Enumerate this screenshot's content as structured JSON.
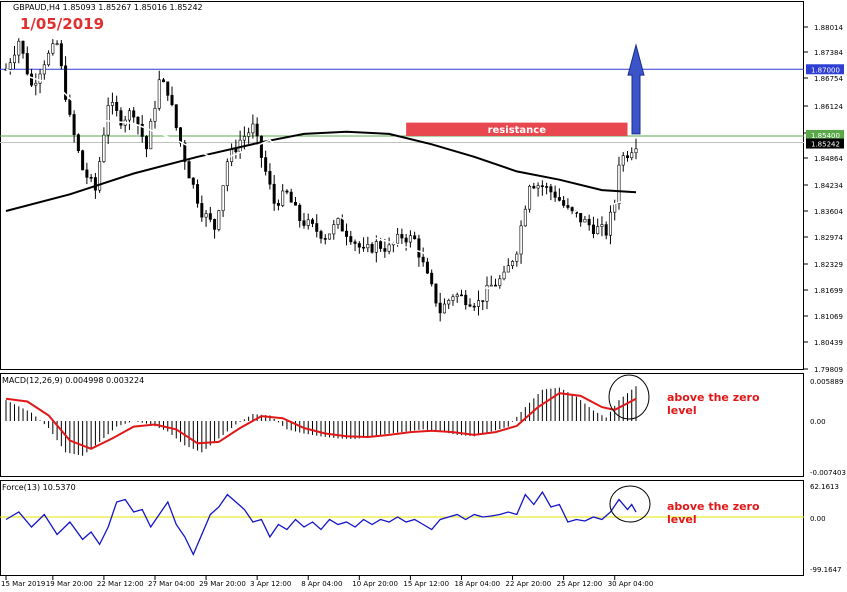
{
  "header": {
    "symbol_line": "GBPAUD,H4  1.85093 1.85267 1.85016 1.85242",
    "date_stamp": "1/05/2019"
  },
  "colors": {
    "date_stamp": "#e03030",
    "candle": "#000000",
    "ma_fast": "#ffffff",
    "ma_slow": "#000000",
    "blue_level": "#2f3fd4",
    "green_level": "#5aa84a",
    "resistance_box": "#e8474f",
    "arrow": "#3b55c9",
    "macd_hist": "#000000",
    "macd_signal": "#e01818",
    "force_line": "#1414c8",
    "force_zero": "#e6e600",
    "annotation": "#e01818"
  },
  "price_panel": {
    "ticks": [
      "1.88014",
      "1.87384",
      "1.86754",
      "1.86124",
      "1.85494",
      "1.84864",
      "1.84234",
      "1.83604",
      "1.82974",
      "1.82329",
      "1.81699",
      "1.81069",
      "1.80439",
      "1.79809"
    ],
    "price_range": [
      1.79809,
      1.88014
    ],
    "blue_level": {
      "value": 1.87,
      "label": "1.87000"
    },
    "green_level": {
      "value": 1.854,
      "label": "1.85400"
    },
    "current_price": {
      "value": 1.85242,
      "label": "1.85242"
    },
    "resistance": {
      "label": "resistance",
      "from_bar": 94,
      "to_bar": 146,
      "price_low": 1.854,
      "price_high": 1.8572
    },
    "arrow": {
      "bar": 148,
      "from_price": 1.8545,
      "to_price": 1.8758
    }
  },
  "macd_panel": {
    "header": "MACD(12,26,9) 0.004998 0.003224",
    "ticks": [
      "0.005889",
      "0.00",
      "-0.007403"
    ],
    "range": [
      -0.007403,
      0.005889
    ],
    "annotation": [
      "above the zero",
      "level"
    ]
  },
  "force_panel": {
    "header": "Force(13) 10.5370",
    "ticks": [
      "62.1613",
      "0.00",
      "-99.1647"
    ],
    "range": [
      -99.1647,
      62.1613
    ],
    "annotation": [
      "above the zero",
      "level"
    ]
  },
  "time_axis": [
    {
      "bar": 0,
      "label": "15 Mar 2019"
    },
    {
      "bar": 11,
      "label": "19 Mar 20:00"
    },
    {
      "bar": 23,
      "label": "22 Mar 12:00"
    },
    {
      "bar": 35,
      "label": "27 Mar 04:00"
    },
    {
      "bar": 47,
      "label": "29 Mar 20:00"
    },
    {
      "bar": 59,
      "label": "3 Apr 12:00"
    },
    {
      "bar": 71,
      "label": "8 Apr 04:00"
    },
    {
      "bar": 83,
      "label": "10 Apr 20:00"
    },
    {
      "bar": 95,
      "label": "15 Apr 12:00"
    },
    {
      "bar": 107,
      "label": "18 Apr 04:00"
    },
    {
      "bar": 119,
      "label": "22 Apr 20:00"
    },
    {
      "bar": 131,
      "label": "25 Apr 12:00"
    },
    {
      "bar": 143,
      "label": "30 Apr 04:00"
    }
  ],
  "chart_data": {
    "type": "candlestick",
    "title": "GBPAUD,H4",
    "bar_count": 149,
    "close_path": [
      [
        0,
        1.87
      ],
      [
        3,
        1.877
      ],
      [
        6,
        1.866
      ],
      [
        9,
        1.872
      ],
      [
        12,
        1.876
      ],
      [
        15,
        1.858
      ],
      [
        18,
        1.846
      ],
      [
        21,
        1.841
      ],
      [
        24,
        1.862
      ],
      [
        27,
        1.858
      ],
      [
        30,
        1.86
      ],
      [
        33,
        1.851
      ],
      [
        36,
        1.867
      ],
      [
        38,
        1.865
      ],
      [
        40,
        1.856
      ],
      [
        43,
        1.845
      ],
      [
        46,
        1.836
      ],
      [
        49,
        1.832
      ],
      [
        52,
        1.848
      ],
      [
        55,
        1.853
      ],
      [
        58,
        1.856
      ],
      [
        60,
        1.849
      ],
      [
        63,
        1.838
      ],
      [
        66,
        1.84
      ],
      [
        69,
        1.834
      ],
      [
        72,
        1.832
      ],
      [
        75,
        1.83
      ],
      [
        78,
        1.833
      ],
      [
        81,
        1.83
      ],
      [
        84,
        1.826
      ],
      [
        87,
        1.828
      ],
      [
        90,
        1.827
      ],
      [
        93,
        1.83
      ],
      [
        96,
        1.829
      ],
      [
        99,
        1.82
      ],
      [
        102,
        1.812
      ],
      [
        105,
        1.816
      ],
      [
        108,
        1.815
      ],
      [
        111,
        1.814
      ],
      [
        114,
        1.818
      ],
      [
        117,
        1.82
      ],
      [
        120,
        1.827
      ],
      [
        123,
        1.843
      ],
      [
        126,
        1.842
      ],
      [
        129,
        1.84
      ],
      [
        132,
        1.836
      ],
      [
        135,
        1.834
      ],
      [
        138,
        1.832
      ],
      [
        141,
        1.831
      ],
      [
        143,
        1.838
      ],
      [
        144,
        1.848
      ],
      [
        146,
        1.85
      ],
      [
        148,
        1.8524
      ]
    ],
    "ma_slow_path": [
      [
        0,
        1.836
      ],
      [
        15,
        1.84
      ],
      [
        30,
        1.845
      ],
      [
        45,
        1.849
      ],
      [
        60,
        1.8525
      ],
      [
        70,
        1.8545
      ],
      [
        80,
        1.855
      ],
      [
        90,
        1.8545
      ],
      [
        100,
        1.852
      ],
      [
        110,
        1.849
      ],
      [
        120,
        1.8455
      ],
      [
        130,
        1.8435
      ],
      [
        140,
        1.841
      ],
      [
        148,
        1.8405
      ]
    ],
    "ma_fast_path": [
      [
        0,
        1.87
      ],
      [
        12,
        1.866
      ],
      [
        20,
        1.858
      ],
      [
        30,
        1.857
      ],
      [
        40,
        1.853
      ],
      [
        50,
        1.848
      ],
      [
        55,
        1.85
      ],
      [
        62,
        1.853
      ],
      [
        70,
        1.845
      ],
      [
        78,
        1.835
      ],
      [
        85,
        1.83
      ],
      [
        92,
        1.828
      ],
      [
        98,
        1.826
      ],
      [
        104,
        1.82
      ],
      [
        110,
        1.818
      ],
      [
        116,
        1.817
      ],
      [
        122,
        1.82
      ],
      [
        128,
        1.83
      ],
      [
        134,
        1.836
      ],
      [
        140,
        1.837
      ],
      [
        144,
        1.838
      ],
      [
        148,
        1.84
      ]
    ],
    "macd_hist_path": [
      [
        0,
        0.003
      ],
      [
        6,
        0.0012
      ],
      [
        10,
        -0.001
      ],
      [
        14,
        -0.0045
      ],
      [
        18,
        -0.005
      ],
      [
        22,
        -0.003
      ],
      [
        26,
        -0.0008
      ],
      [
        30,
        0.0
      ],
      [
        34,
        -0.0005
      ],
      [
        38,
        -0.0015
      ],
      [
        42,
        -0.0035
      ],
      [
        46,
        -0.0045
      ],
      [
        50,
        -0.0025
      ],
      [
        54,
        -0.0005
      ],
      [
        58,
        0.001
      ],
      [
        62,
        0.0008
      ],
      [
        66,
        -0.0012
      ],
      [
        70,
        -0.0018
      ],
      [
        74,
        -0.0022
      ],
      [
        78,
        -0.0025
      ],
      [
        82,
        -0.0026
      ],
      [
        86,
        -0.0022
      ],
      [
        90,
        -0.0018
      ],
      [
        94,
        -0.0015
      ],
      [
        98,
        -0.0012
      ],
      [
        102,
        -0.0015
      ],
      [
        106,
        -0.002
      ],
      [
        110,
        -0.0022
      ],
      [
        114,
        -0.0015
      ],
      [
        118,
        -0.0008
      ],
      [
        122,
        0.002
      ],
      [
        126,
        0.0045
      ],
      [
        130,
        0.0048
      ],
      [
        134,
        0.0035
      ],
      [
        138,
        0.0015
      ],
      [
        141,
        0.0005
      ],
      [
        144,
        0.003
      ],
      [
        148,
        0.005
      ]
    ],
    "macd_signal_path": [
      [
        0,
        0.0032
      ],
      [
        5,
        0.0028
      ],
      [
        10,
        0.0008
      ],
      [
        15,
        -0.0028
      ],
      [
        20,
        -0.004
      ],
      [
        25,
        -0.0025
      ],
      [
        30,
        -0.0008
      ],
      [
        35,
        -0.0005
      ],
      [
        40,
        -0.0012
      ],
      [
        45,
        -0.0032
      ],
      [
        50,
        -0.003
      ],
      [
        55,
        -0.001
      ],
      [
        60,
        0.0007
      ],
      [
        65,
        0.0004
      ],
      [
        70,
        -0.001
      ],
      [
        75,
        -0.0018
      ],
      [
        80,
        -0.0022
      ],
      [
        85,
        -0.0023
      ],
      [
        90,
        -0.002
      ],
      [
        95,
        -0.0016
      ],
      [
        100,
        -0.0014
      ],
      [
        105,
        -0.0016
      ],
      [
        110,
        -0.002
      ],
      [
        115,
        -0.0016
      ],
      [
        120,
        -0.0007
      ],
      [
        125,
        0.002
      ],
      [
        130,
        0.004
      ],
      [
        135,
        0.0036
      ],
      [
        140,
        0.002
      ],
      [
        143,
        0.0016
      ],
      [
        148,
        0.0032
      ]
    ],
    "force_path": [
      [
        0,
        -5
      ],
      [
        3,
        10
      ],
      [
        6,
        -20
      ],
      [
        9,
        5
      ],
      [
        12,
        -35
      ],
      [
        15,
        -10
      ],
      [
        18,
        -45
      ],
      [
        20,
        -30
      ],
      [
        22,
        -55
      ],
      [
        24,
        -20
      ],
      [
        26,
        30
      ],
      [
        28,
        35
      ],
      [
        30,
        10
      ],
      [
        32,
        15
      ],
      [
        34,
        -20
      ],
      [
        36,
        5
      ],
      [
        38,
        30
      ],
      [
        40,
        -15
      ],
      [
        42,
        -40
      ],
      [
        44,
        -75
      ],
      [
        46,
        -35
      ],
      [
        48,
        5
      ],
      [
        50,
        20
      ],
      [
        52,
        45
      ],
      [
        54,
        30
      ],
      [
        56,
        15
      ],
      [
        58,
        -10
      ],
      [
        60,
        -5
      ],
      [
        62,
        -40
      ],
      [
        64,
        -15
      ],
      [
        66,
        -25
      ],
      [
        68,
        -5
      ],
      [
        70,
        -20
      ],
      [
        72,
        -10
      ],
      [
        74,
        -25
      ],
      [
        76,
        -5
      ],
      [
        78,
        -15
      ],
      [
        80,
        -10
      ],
      [
        82,
        -20
      ],
      [
        84,
        -5
      ],
      [
        86,
        -15
      ],
      [
        88,
        -5
      ],
      [
        90,
        -10
      ],
      [
        92,
        0
      ],
      [
        94,
        -10
      ],
      [
        96,
        -5
      ],
      [
        98,
        -15
      ],
      [
        100,
        -25
      ],
      [
        102,
        -5
      ],
      [
        104,
        0
      ],
      [
        106,
        5
      ],
      [
        108,
        -5
      ],
      [
        110,
        5
      ],
      [
        112,
        0
      ],
      [
        114,
        2
      ],
      [
        116,
        5
      ],
      [
        118,
        10
      ],
      [
        120,
        5
      ],
      [
        122,
        45
      ],
      [
        124,
        25
      ],
      [
        126,
        50
      ],
      [
        128,
        20
      ],
      [
        130,
        25
      ],
      [
        132,
        -10
      ],
      [
        134,
        -5
      ],
      [
        136,
        -8
      ],
      [
        138,
        0
      ],
      [
        140,
        -5
      ],
      [
        142,
        10
      ],
      [
        144,
        35
      ],
      [
        146,
        15
      ],
      [
        147,
        25
      ],
      [
        148,
        10
      ]
    ]
  }
}
